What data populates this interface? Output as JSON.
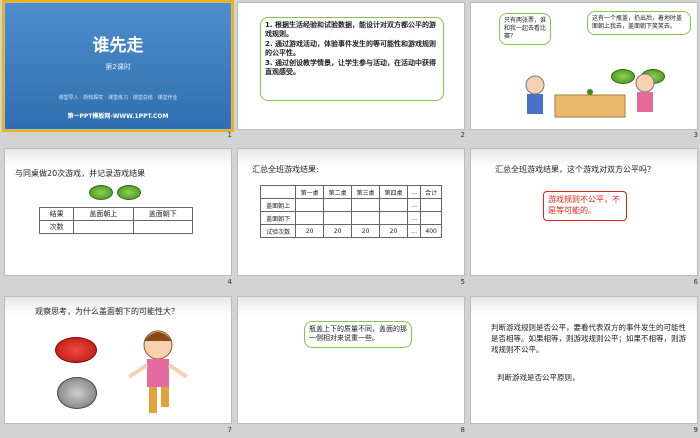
{
  "slides": [
    {
      "num": "1",
      "title": "谁先走",
      "subtitle": "第2课时",
      "menu": "课堂导入 · 新知探究 · 课堂练习 · 课堂总结 · 课堂作业",
      "site": "第一PPT模板网-WWW.1PPT.COM"
    },
    {
      "num": "2",
      "lines": [
        "1. 根据生活经验和试验数据，能设计对双方都公平的游戏规则。",
        "2. 通过游戏活动，体验事件发生的等可能性和游戏规则的公平性。",
        "3. 通过创设教学情景，让学生参与活动，在活动中获得直观感受。"
      ]
    },
    {
      "num": "3",
      "bubble_left": "只有两张票，谁和我一起去看比赛？",
      "bubble_right": "这有一个瓶盖，扔出后，着地时盖面朝上我去，盖面朝下笑笑去。"
    },
    {
      "num": "4",
      "title": "与同桌做20次游戏，并记录游戏结果",
      "table": {
        "headers": [
          "结果",
          "盖面朝上",
          "盖面朝下"
        ],
        "rows": [
          [
            "次数",
            "",
            ""
          ]
        ]
      }
    },
    {
      "num": "5",
      "title": "汇总全班游戏结果:",
      "table": {
        "headers": [
          "",
          "第一桌",
          "第二桌",
          "第三桌",
          "第四桌",
          "…",
          "合计"
        ],
        "rows": [
          [
            "盖面朝上",
            "",
            "",
            "",
            "",
            "…",
            ""
          ],
          [
            "盖面朝下",
            "",
            "",
            "",
            "",
            "…",
            ""
          ],
          [
            "试验次数",
            "20",
            "20",
            "20",
            "20",
            "…",
            "400"
          ]
        ]
      }
    },
    {
      "num": "6",
      "title": "汇总全班游戏结果，这个游戏对双方公平吗？",
      "answer": "游戏规则不公平，不是等可能的。"
    },
    {
      "num": "7",
      "title": "观察思考，为什么盖面朝下的可能性大？"
    },
    {
      "num": "8",
      "bubble": "瓶盖上下的质量不同，盖面的那一侧相对来说重一些。"
    },
    {
      "num": "9",
      "text1": "判断游戏规则是否公平，要看代表双方的事件发生的可能性是否相等。如果相等，则游戏规则公平；如果不相等，则游戏规则不公平。",
      "text2": "判断游戏是否公平原则，"
    }
  ]
}
